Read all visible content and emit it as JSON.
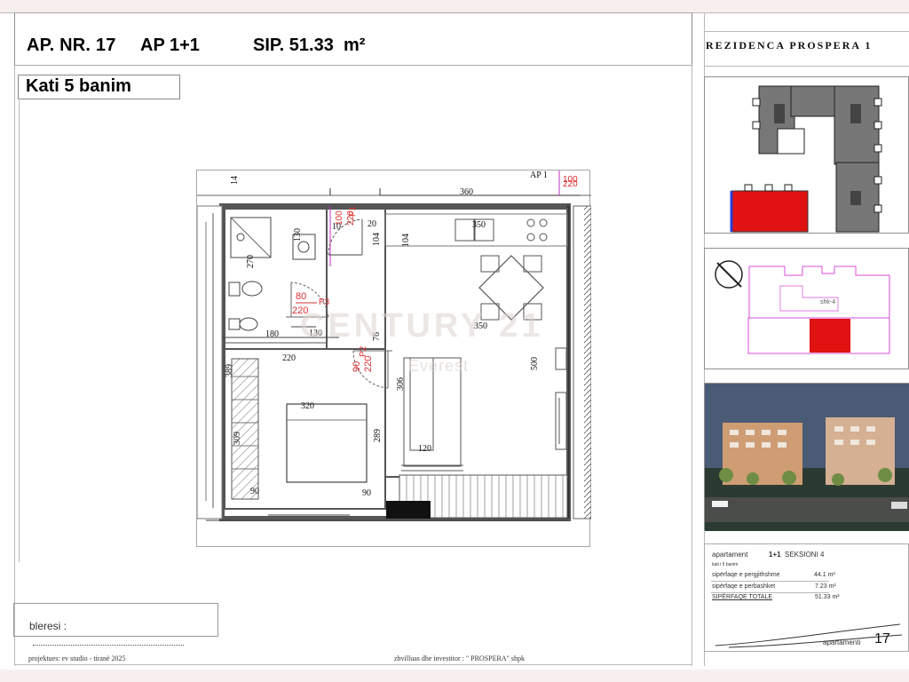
{
  "header": {
    "apartment_number": "AP. NR. 17",
    "apartment_type": "AP 1+1",
    "area": "SIP. 51.33",
    "area_unit": "m²",
    "floor": "Kati 5 banim",
    "project_title": "REZIDENCA PROSPERA 1"
  },
  "plan": {
    "watermark": "CENTURY 21",
    "watermark_sub": "Everest",
    "doors": [
      "P1",
      "P2",
      "P3",
      "P2"
    ],
    "dimensions": [
      "360",
      "350",
      "104",
      "180",
      "130",
      "350",
      "220",
      "320",
      "309",
      "289",
      "306",
      "120",
      "90",
      "90",
      "389",
      "130",
      "220",
      "10",
      "20"
    ]
  },
  "buyer": {
    "label": "bleresi :"
  },
  "footer": {
    "project": "projektues:   ev studio   -   tiranë 2025",
    "developer": "zhvilluas dhe investitor :  \" PROSPERA\" shpk"
  },
  "sidebar": {
    "location_label": "shk-4",
    "table_title": "apartament",
    "table_type": "1+1",
    "table_section": "SEKSIONI 4",
    "floor_label": "kati i 5 banim",
    "rows": [
      {
        "label": "sipërfaqe e pergjithshme",
        "value": "44.1 m²"
      },
      {
        "label": "sipërfaqe e perbashket",
        "value": "7.23 m²"
      },
      {
        "label": "SIPËRFAQE TOTALE",
        "value": "51.33 m²"
      }
    ],
    "apartment_label": "apartamenti",
    "apartment_number": "17"
  },
  "colors": {
    "accent_red": "#e01212",
    "dimension_red": "#d92f2f",
    "line_gray": "#8f8f8f"
  }
}
